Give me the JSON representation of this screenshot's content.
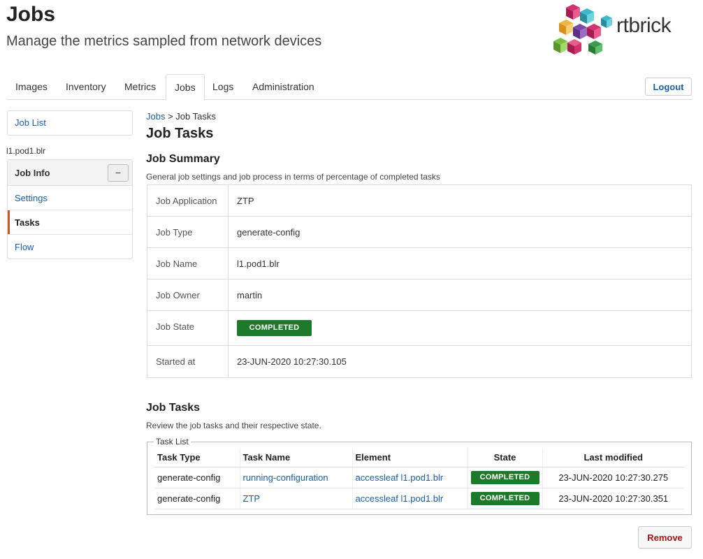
{
  "header": {
    "title": "Jobs",
    "subtitle": "Manage the metrics sampled from network devices",
    "logo_text": "rtbrick"
  },
  "tabs": [
    {
      "label": "Images",
      "active": false
    },
    {
      "label": "Inventory",
      "active": false
    },
    {
      "label": "Metrics",
      "active": false
    },
    {
      "label": "Jobs",
      "active": true
    },
    {
      "label": "Logs",
      "active": false
    },
    {
      "label": "Administration",
      "active": false
    }
  ],
  "logout_label": "Logout",
  "sidebar": {
    "job_list_label": "Job List",
    "job_name": "l1.pod1.blr",
    "job_info_title": "Job Info",
    "collapse_symbol": "−",
    "items": [
      {
        "label": "Settings",
        "active": false
      },
      {
        "label": "Tasks",
        "active": true
      },
      {
        "label": "Flow",
        "active": false
      }
    ]
  },
  "breadcrumb": {
    "parent": "Jobs",
    "separator": " > ",
    "current": "Job Tasks"
  },
  "main": {
    "title": "Job Tasks",
    "summary_title": "Job Summary",
    "summary_desc": "General job settings and job process in terms of percentage of completed tasks",
    "summary_rows": [
      {
        "label": "Job Application",
        "value": "ZTP"
      },
      {
        "label": "Job Type",
        "value": "generate-config"
      },
      {
        "label": "Job Name",
        "value": "l1.pod1.blr"
      },
      {
        "label": "Job Owner",
        "value": "martin"
      },
      {
        "label": "Job State",
        "value": "COMPLETED"
      },
      {
        "label": "Started at",
        "value": "23-JUN-2020 10:27:30.105"
      }
    ],
    "tasks_title": "Job Tasks",
    "tasks_desc": "Review the job tasks and their respective state.",
    "task_list_legend": "Task List",
    "task_columns": [
      "Task Type",
      "Task Name",
      "Element",
      "State",
      "Last modified"
    ],
    "tasks": [
      {
        "type": "generate-config",
        "name": "running-configuration",
        "element": "accessleaf l1.pod1.blr",
        "state": "COMPLETED",
        "modified": "23-JUN-2020 10:27:30.275"
      },
      {
        "type": "generate-config",
        "name": "ZTP",
        "element": "accessleaf l1.pod1.blr",
        "state": "COMPLETED",
        "modified": "23-JUN-2020 10:27:30.351"
      }
    ],
    "remove_label": "Remove"
  },
  "colors": {
    "completed": "#1d7a2a",
    "link": "#1a5fa8",
    "active_accent": "#c9582b",
    "remove_text": "#a31515"
  }
}
